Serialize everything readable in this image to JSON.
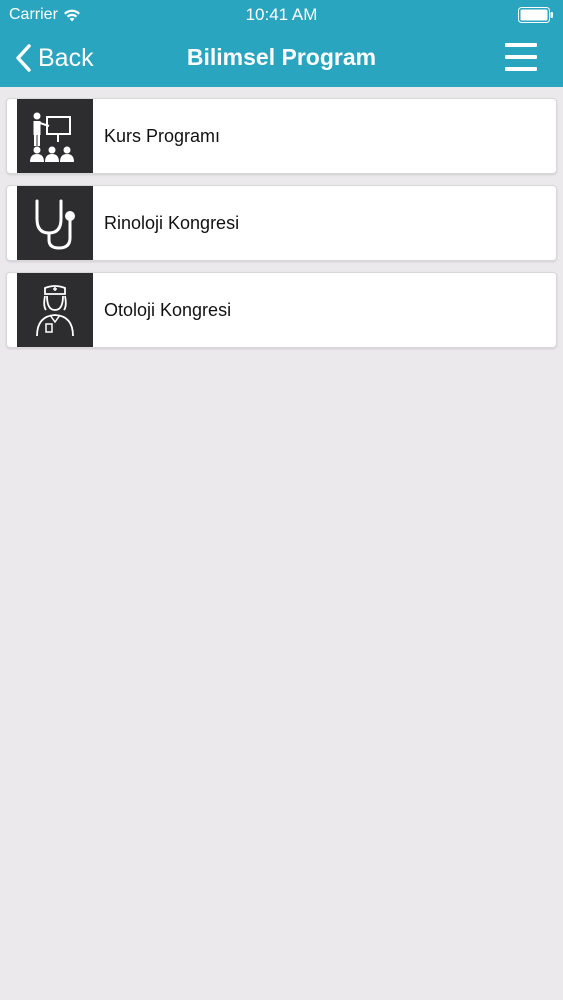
{
  "status_bar": {
    "carrier": "Carrier",
    "time": "10:41 AM"
  },
  "navbar": {
    "back_label": "Back",
    "title": "Bilimsel Program"
  },
  "items": [
    {
      "label": "Kurs Programı",
      "icon": "presentation-icon"
    },
    {
      "label": "Rinoloji Kongresi",
      "icon": "stethoscope-icon"
    },
    {
      "label": "Otoloji Kongresi",
      "icon": "nurse-icon"
    }
  ],
  "colors": {
    "accent": "#2aa5bf",
    "icon_bg": "#2d2c2e",
    "background": "#ebe9ec"
  }
}
